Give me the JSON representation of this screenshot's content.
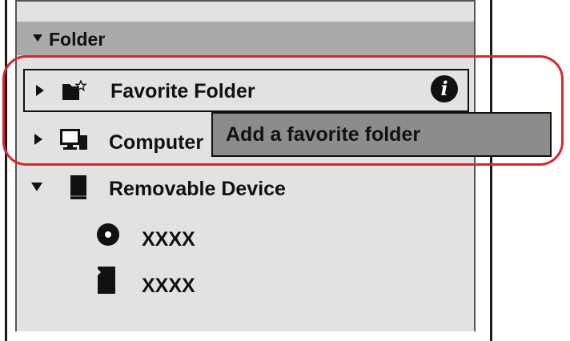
{
  "folder_section": {
    "label": "Folder"
  },
  "items": {
    "favorite": {
      "label": "Favorite Folder",
      "info_icon": "i"
    },
    "computer": {
      "label": "Computer"
    },
    "removable": {
      "label": "Removable Device"
    }
  },
  "devices": [
    {
      "label": "XXXX",
      "icon": "disc-icon"
    },
    {
      "label": "XXXX",
      "icon": "sd-card-icon"
    }
  ],
  "tooltip": {
    "text": "Add a favorite folder"
  },
  "colors": {
    "highlight": "#d9262e",
    "tooltip_bg": "#8c8c8c",
    "panel_bg": "#e2e2e2",
    "header_bg": "#aaaaaa"
  }
}
